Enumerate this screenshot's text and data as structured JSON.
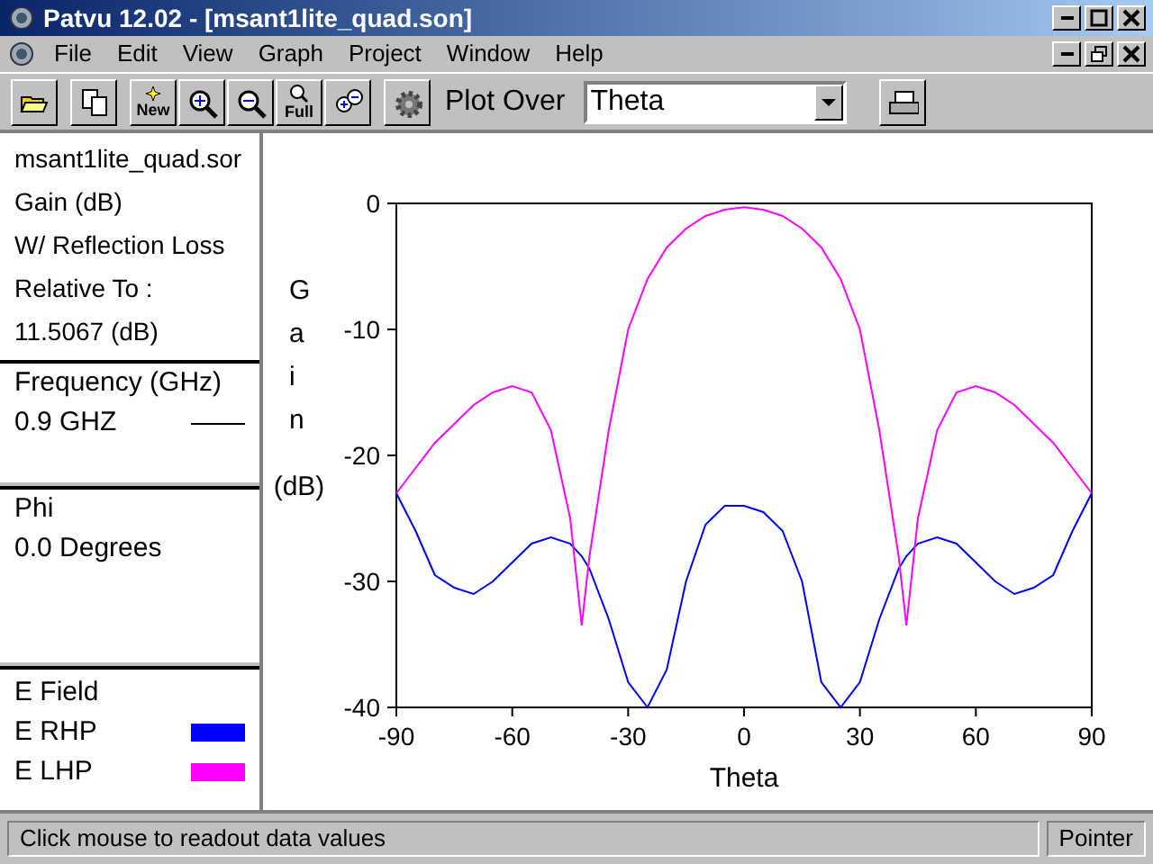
{
  "window": {
    "title": "Patvu 12.02 - [msant1lite_quad.son]"
  },
  "menu": [
    "File",
    "Edit",
    "View",
    "Graph",
    "Project",
    "Window",
    "Help"
  ],
  "toolbar": {
    "buttons": [
      {
        "kind": "open"
      },
      {
        "kind": "copy"
      },
      {
        "kind": "new",
        "label": "New"
      },
      {
        "kind": "zoom_in"
      },
      {
        "kind": "zoom_out"
      },
      {
        "kind": "full",
        "label": "Full"
      },
      {
        "kind": "zoom_both"
      },
      {
        "kind": "gear"
      }
    ],
    "plot_over_label": "Plot Over",
    "plot_over_value": "Theta",
    "print": {
      "kind": "printer"
    }
  },
  "info_panel": {
    "lines": [
      "msant1lite_quad.sor",
      "Gain (dB)",
      "W/ Reflection Loss",
      "Relative To :",
      "11.5067 (dB)"
    ]
  },
  "frequency_panel": {
    "heading": "Frequency (GHz)",
    "value": "0.9 GHZ"
  },
  "phi_panel": {
    "heading": "Phi",
    "value": "0.0 Degrees"
  },
  "legend": {
    "heading": "E Field"
  },
  "y_unit": "(dB)",
  "chart_data": {
    "type": "line",
    "xlabel": "Theta",
    "ylabel": "Gain",
    "xlim": [
      -90,
      90
    ],
    "ylim": [
      -40,
      0
    ],
    "xticks": [
      -90,
      -60,
      -30,
      0,
      30,
      60,
      90
    ],
    "yticks": [
      0,
      -10,
      -20,
      -30,
      -40
    ],
    "x": [
      -90,
      -85,
      -80,
      -75,
      -70,
      -65,
      -60,
      -55,
      -50,
      -45,
      -42,
      -40,
      -35,
      -30,
      -25,
      -20,
      -15,
      -10,
      -5,
      0,
      5,
      10,
      15,
      20,
      25,
      30,
      35,
      40,
      42,
      45,
      50,
      55,
      60,
      65,
      70,
      75,
      80,
      85,
      90
    ],
    "series": [
      {
        "name": "E RHP",
        "color": "#0000ff",
        "values": [
          -23,
          -26,
          -29.5,
          -30.5,
          -31,
          -30,
          -28.5,
          -27,
          -26.5,
          -27,
          -28,
          -29,
          -33,
          -38,
          -40,
          -37,
          -30,
          -25.5,
          -24,
          -24,
          -24.5,
          -26,
          -30,
          -38,
          -40,
          -38,
          -33,
          -29,
          -28,
          -27,
          -26.5,
          -27,
          -28.5,
          -30,
          -31,
          -30.5,
          -29.5,
          -26,
          -23
        ]
      },
      {
        "name": "E LHP",
        "color": "#ff00ff",
        "values": [
          -23,
          -21,
          -19,
          -17.5,
          -16,
          -15,
          -14.5,
          -15,
          -18,
          -25,
          -33.5,
          -28,
          -18,
          -10,
          -6,
          -3.5,
          -2,
          -1,
          -0.5,
          -0.3,
          -0.5,
          -1,
          -2,
          -3.5,
          -6,
          -10,
          -18,
          -28,
          -33.5,
          -25,
          -18,
          -15,
          -14.5,
          -15,
          -16,
          -17.5,
          -19,
          -21,
          -23
        ]
      }
    ]
  },
  "status_bar": {
    "message": "Click mouse to readout data values",
    "mode": "Pointer"
  }
}
